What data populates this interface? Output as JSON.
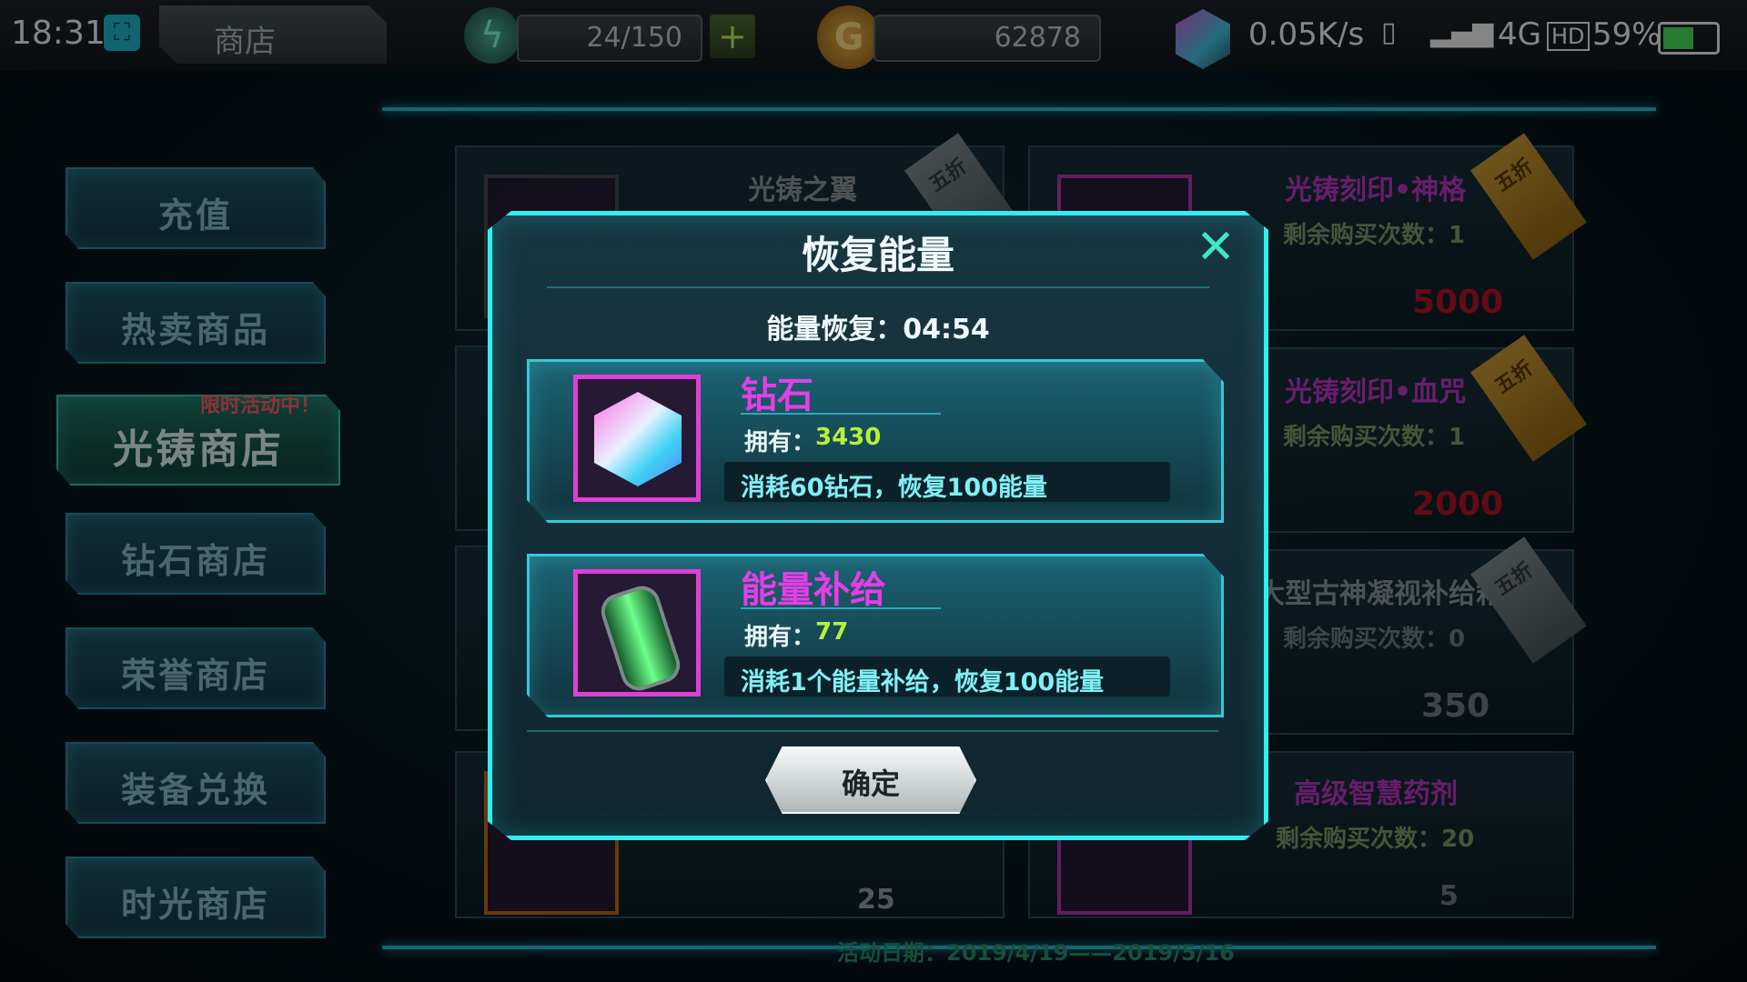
{
  "status_bar": {
    "time": "18:31",
    "network_speed": "0.05K/s",
    "network_type": "4G",
    "hd": "HD",
    "battery_percent": "59%",
    "battery_level": 0.59
  },
  "header": {
    "shop_tab": "商店",
    "energy": "24/150",
    "gold": "62878"
  },
  "sidebar": {
    "items": [
      {
        "label": "充值"
      },
      {
        "label": "热卖商品"
      },
      {
        "label": "光铸商店",
        "active": true,
        "badge": "限时活动中！"
      },
      {
        "label": "钻石商店"
      },
      {
        "label": "荣誉商店"
      },
      {
        "label": "装备兑换"
      },
      {
        "label": "时光商店"
      }
    ]
  },
  "shop_cards": {
    "left_top_title": "光铸之翼",
    "left_top_ribbon": "五折",
    "left_bottom_price": "25",
    "right": [
      {
        "title": "光铸刻印•神格",
        "remaining": "剩余购买次数：1",
        "price": "5000",
        "ribbon": "五折"
      },
      {
        "title": "光铸刻印•血咒",
        "remaining": "剩余购买次数：1",
        "price": "2000",
        "ribbon": "五折"
      },
      {
        "title": "大型古神凝视补给箱",
        "remaining": "剩余购买次数：0",
        "price": "350",
        "ribbon": "五折"
      },
      {
        "title": "高级智慧药剂",
        "remaining": "剩余购买次数：20",
        "price": "5"
      }
    ]
  },
  "modal": {
    "title": "恢复能量",
    "timer_label": "能量恢复：04:54",
    "options": [
      {
        "name": "钻石",
        "own_label": "拥有：",
        "own_value": "3430",
        "desc": "消耗60钻石，恢复100能量",
        "icon": "diamond-icon"
      },
      {
        "name": "能量补给",
        "own_label": "拥有：",
        "own_value": "77",
        "desc": "消耗1个能量补给，恢复100能量",
        "icon": "energy-canister-icon"
      }
    ],
    "confirm": "确定"
  },
  "footer": {
    "event_date": "活动日期：2019/4/19——2019/5/16"
  },
  "colors": {
    "accent": "#2ef0f0",
    "item_name": "#e43ee8",
    "price_red": "#d8142c",
    "owned_value": "#b7ef3c"
  }
}
